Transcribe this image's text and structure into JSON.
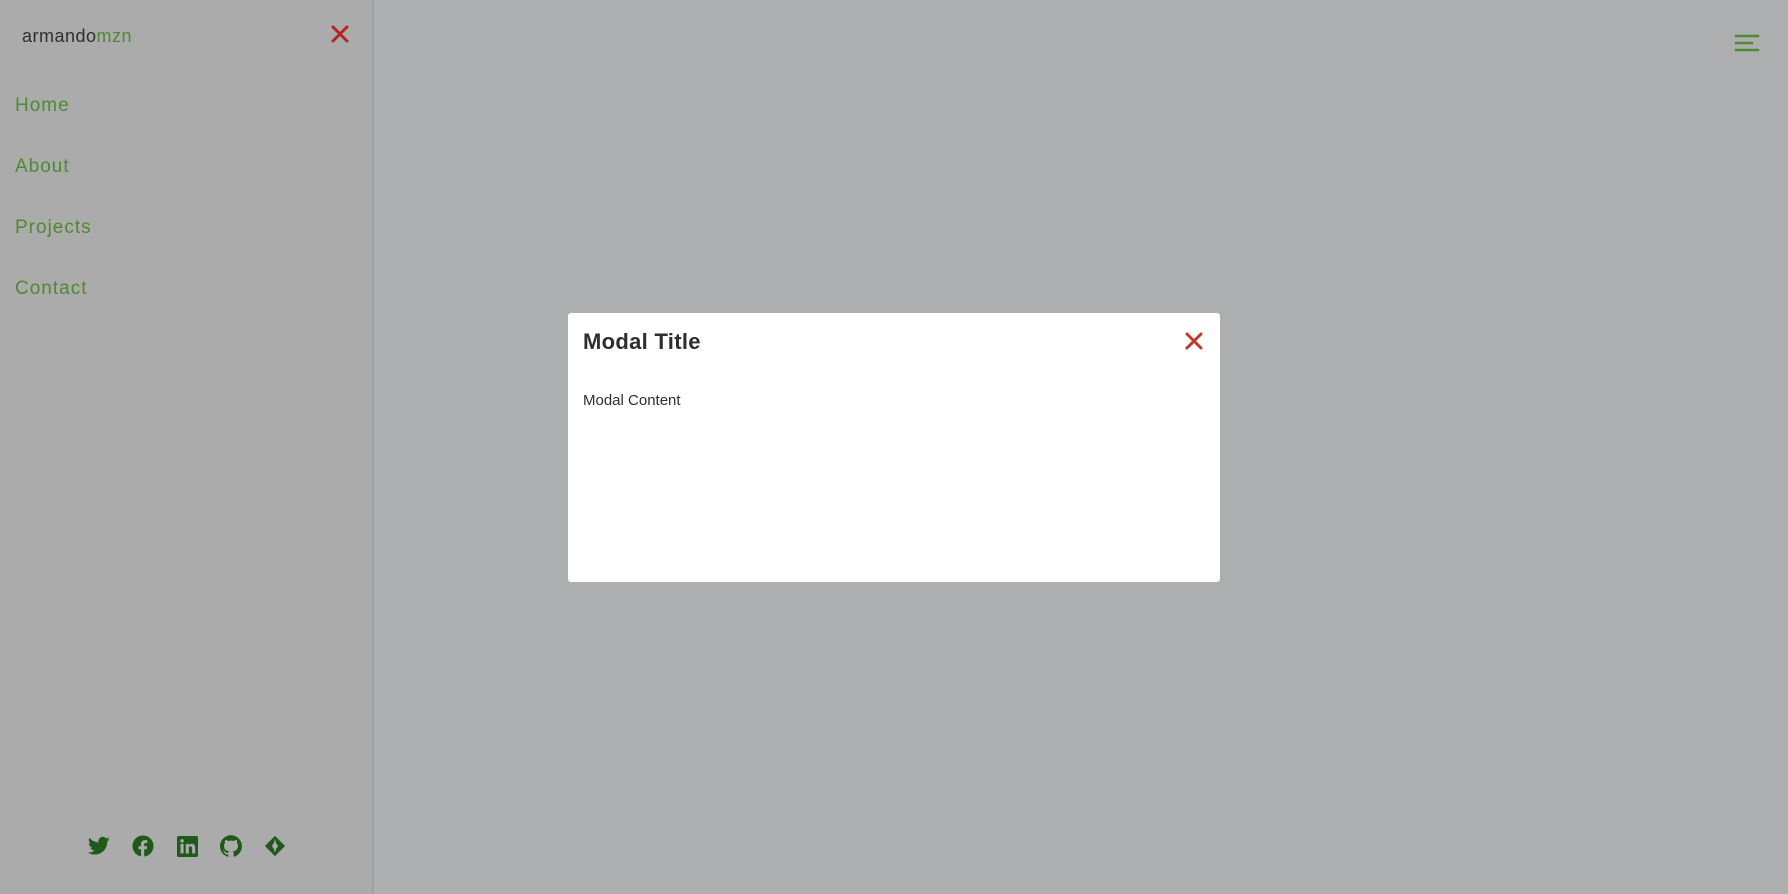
{
  "brand": {
    "prefix": "armando",
    "accent": "mzn"
  },
  "sidebar": {
    "close_icon": "close-icon",
    "items": [
      {
        "label": "Home"
      },
      {
        "label": "About"
      },
      {
        "label": "Projects"
      },
      {
        "label": "Contact"
      }
    ],
    "socials": [
      "twitter-icon",
      "facebook-icon",
      "linkedin-icon",
      "github-icon",
      "gitlab-icon"
    ]
  },
  "header": {
    "menu_icon": "hamburger-menu-icon"
  },
  "modal": {
    "title": "Modal Title",
    "content": "Modal Content",
    "close_icon": "close-icon"
  },
  "colors": {
    "accent_green": "#4d8a30",
    "icon_dark_green": "#1f5a1a",
    "close_red": "#c0392b",
    "overlay": "#adaeb0"
  }
}
